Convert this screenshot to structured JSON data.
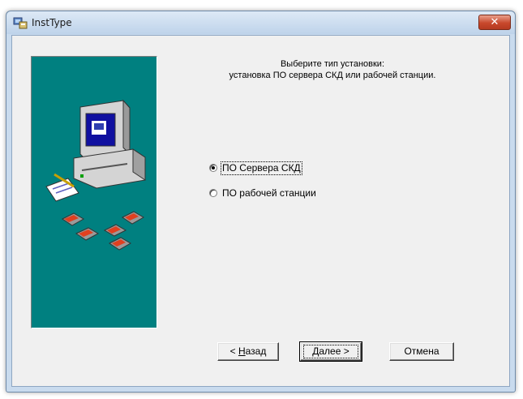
{
  "window": {
    "title": "InstType",
    "close_glyph": "✕"
  },
  "instruction": {
    "line1": "Выберите тип установки:",
    "line2": "установка ПО сервера СКД или рабочей станции."
  },
  "options": [
    {
      "label": "ПО Сервера СКД",
      "selected": true
    },
    {
      "label": "ПО рабочей станции",
      "selected": false
    }
  ],
  "buttons": {
    "back_prefix": "< ",
    "back_accel": "Н",
    "back_rest": "азад",
    "next_accel": "Д",
    "next_rest": "алее >",
    "cancel_label": "Отмена"
  },
  "icons": {
    "title": "installer-icon",
    "side": "computer-illustration"
  },
  "colors": {
    "side_panel": "#008080",
    "dialog_bg": "#f0f0f0",
    "close_button": "#c8482c"
  }
}
